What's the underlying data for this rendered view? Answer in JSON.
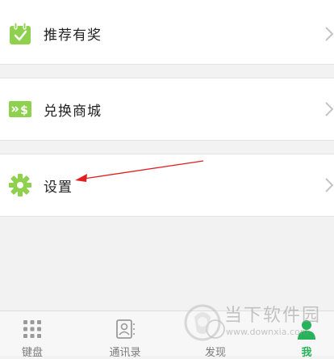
{
  "menu": {
    "items": [
      {
        "label": "推荐有奖",
        "icon": "calendar-check-icon"
      },
      {
        "label": "兑换商城",
        "icon": "exchange-dollar-icon"
      },
      {
        "label": "设置",
        "icon": "gear-icon"
      }
    ]
  },
  "tabbar": {
    "tabs": [
      {
        "label": "键盘",
        "icon": "keypad-icon",
        "active": false
      },
      {
        "label": "通讯录",
        "icon": "contacts-icon",
        "active": false
      },
      {
        "label": "发现",
        "icon": "discover-icon",
        "active": false
      },
      {
        "label": "我",
        "icon": "person-icon",
        "active": true
      }
    ]
  },
  "watermark": {
    "name": "当下软件园",
    "url": "www.downxia.com"
  },
  "colors": {
    "accent_green": "#27b35a",
    "icon_green": "#8fd14f",
    "arrow_red": "#e02020"
  }
}
